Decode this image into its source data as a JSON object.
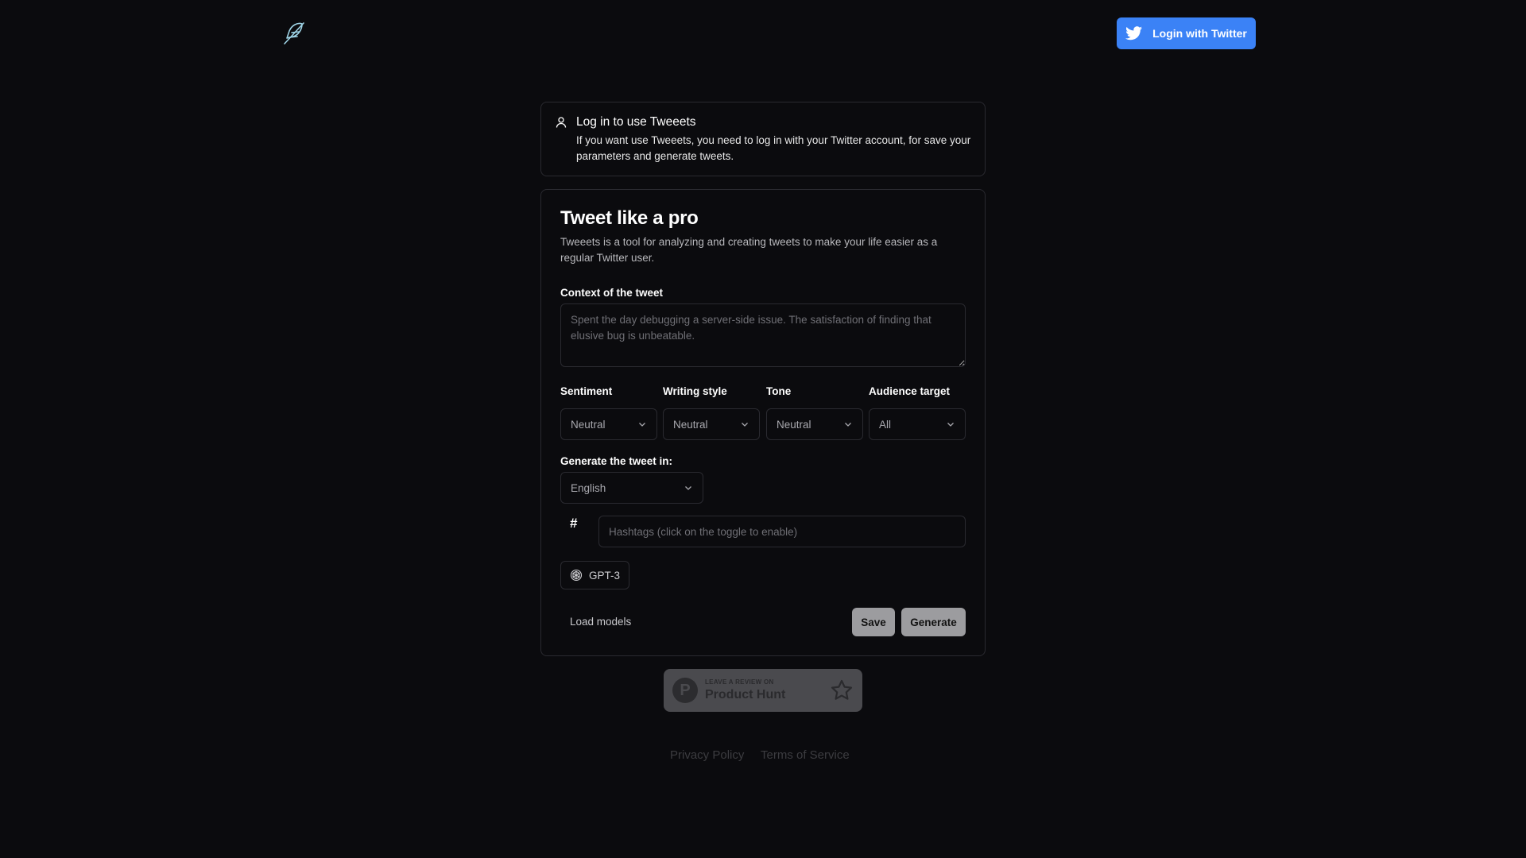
{
  "header": {
    "login_label": "Login with Twitter"
  },
  "alert": {
    "title": "Log in to use Tweeets",
    "body": "If you want use Tweeets, you need to log in with your Twitter account, for save your parameters and generate tweets."
  },
  "card": {
    "title": "Tweet like a pro",
    "description": "Tweeets is a tool for analyzing and creating tweets to make your life easier as a regular Twitter user.",
    "context_label": "Context of the tweet",
    "context_placeholder": "Spent the day debugging a server-side issue. The satisfaction of finding that elusive bug is unbeatable.",
    "selects": [
      {
        "label": "Sentiment",
        "value": "Neutral"
      },
      {
        "label": "Writing style",
        "value": "Neutral"
      },
      {
        "label": "Tone",
        "value": "Neutral"
      },
      {
        "label": "Audience target",
        "value": "All"
      }
    ],
    "language_label": "Generate the tweet in:",
    "language_value": "English",
    "hashtag_symbol": "#",
    "hashtags_placeholder": "Hashtags (click on the toggle to enable)",
    "model_label": "GPT-3",
    "load_models_label": "Load models",
    "save_label": "Save",
    "generate_label": "Generate"
  },
  "product_hunt": {
    "small_text": "LEAVE A REVIEW ON",
    "big_text": "Product Hunt",
    "logo_letter": "P"
  },
  "footer": {
    "privacy": "Privacy Policy",
    "terms": "Terms of Service"
  },
  "colors": {
    "background": "#0b0b0e",
    "accent": "#3b82f6",
    "border": "#2a2a30"
  }
}
